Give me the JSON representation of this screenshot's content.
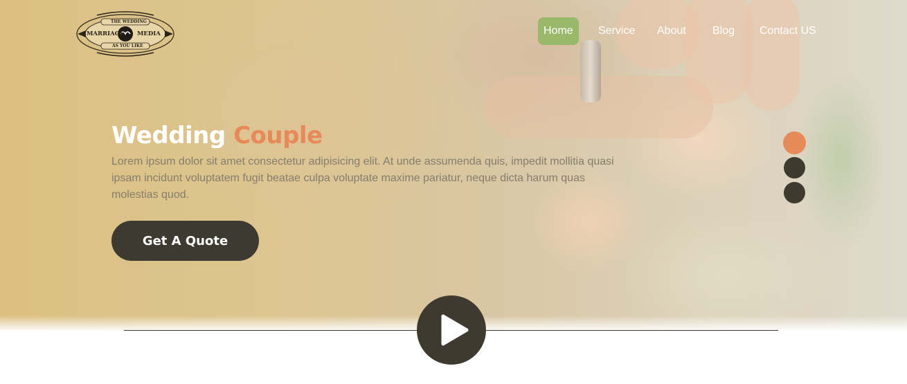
{
  "brand": {
    "logo_top_text": "THE WEDDING",
    "logo_left_text": "MARRIAGE",
    "logo_right_text": "MEDIA",
    "logo_bottom_text": "AS YOU LIKE"
  },
  "nav": {
    "items": [
      {
        "label": "Home",
        "active": true
      },
      {
        "label": "Service",
        "active": false
      },
      {
        "label": "About",
        "active": false
      },
      {
        "label": "Blog",
        "active": false
      },
      {
        "label": "Contact US",
        "active": false
      }
    ]
  },
  "hero": {
    "title_main": "Wedding ",
    "title_accent": "Couple",
    "description": "Lorem ipsum dolor sit amet consectetur adipisicing elit. At unde assumenda quis, impedit mollitia quasi ipsam incidunt voluptatem fugit beatae culpa voluptate maxime pariatur, neque dicta harum quas molestias quod.",
    "cta_label": "Get A Quote"
  },
  "slider": {
    "dots": 3,
    "active_index": 0
  },
  "colors": {
    "accent": "#e8895a",
    "nav_active": "#9ab86a",
    "dark": "#3c3a31",
    "text_muted": "#857d6c"
  },
  "icons": {
    "play": "play-icon",
    "logo": "wedding-logo-emblem"
  }
}
